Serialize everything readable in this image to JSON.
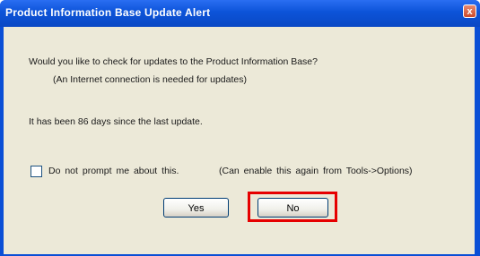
{
  "window": {
    "title": "Product Information Base Update Alert",
    "close_glyph": "x"
  },
  "message": {
    "question": "Would you like to check for updates to the Product Information Base?",
    "note": "(An Internet connection is needed for updates)",
    "days_since": "It has been 86 days since the last update."
  },
  "checkbox": {
    "label": "Do not prompt me about this.",
    "hint": "(Can enable this again from Tools->Options)",
    "checked": false
  },
  "buttons": {
    "yes_label": "Yes",
    "no_label": "No"
  },
  "highlight": {
    "target": "no-button",
    "color": "#e60000"
  },
  "colors": {
    "titlebar": "#0c53d8",
    "client": "#ece9d8",
    "close_button": "#cc4a2b"
  }
}
